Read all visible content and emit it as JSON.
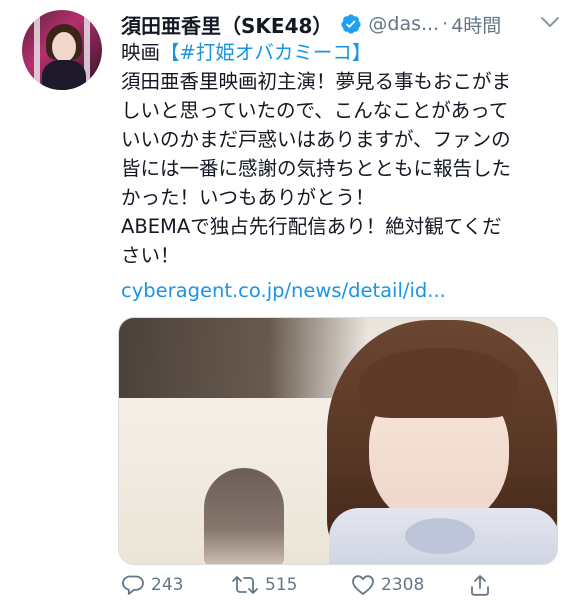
{
  "tweet": {
    "author_name": "須田亜香里（SKE48）",
    "handle": "@das...",
    "separator": "·",
    "time": "4時間",
    "lines": [
      {
        "prefix": "映画",
        "hashtag": "【#打姫オバカミーコ】"
      },
      {
        "text": "須田亜香里映画初主演！夢見る事もおこがま"
      },
      {
        "text": "しいと思っていたので、こんなことがあって"
      },
      {
        "text": "いいのかまだ戸惑いはありますが、ファンの"
      },
      {
        "text": "皆には一番に感謝の気持ちとともに報告した"
      },
      {
        "text": "かった！いつもありがとう！"
      },
      {
        "text": "ABEMAで独占先行配信あり！絶対観てくだ"
      },
      {
        "text": "さい！"
      }
    ],
    "link": "cyberagent.co.jp/news/detail/id..."
  },
  "actions": {
    "replies": "243",
    "retweets": "515",
    "likes": "2308"
  },
  "colors": {
    "link": "#1b95e0",
    "muted": "#657786",
    "verified": "#1da1f2",
    "text": "#141823"
  },
  "icons": {
    "verified": "verified-badge-icon",
    "caret": "chevron-down-icon",
    "reply": "reply-icon",
    "retweet": "retweet-icon",
    "like": "heart-icon",
    "share": "share-icon"
  }
}
